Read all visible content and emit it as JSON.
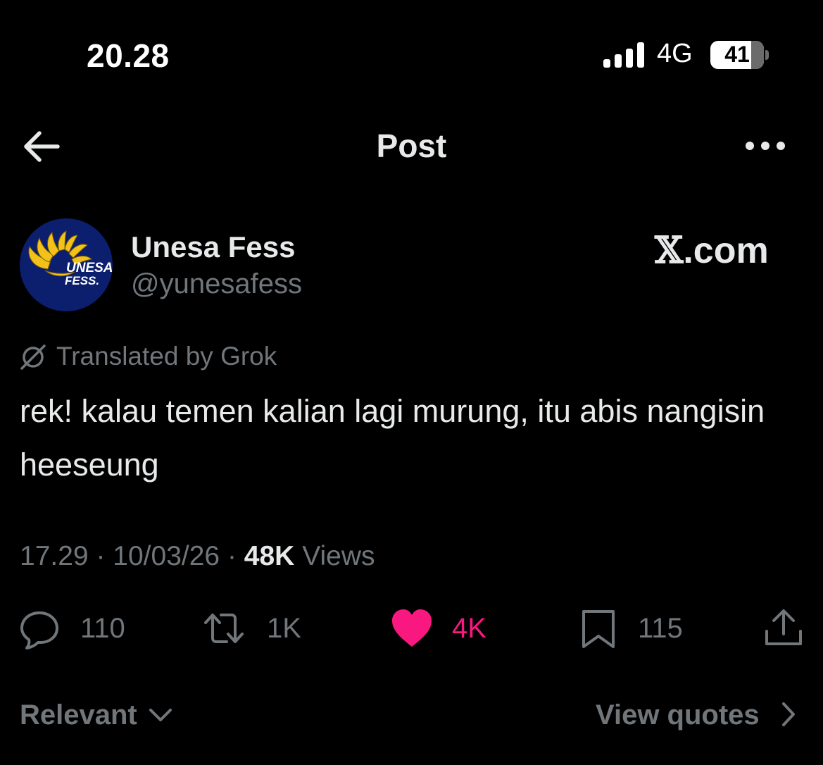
{
  "status_bar": {
    "time": "20.28",
    "network": "4G",
    "battery": "41",
    "battery_level": 0.41
  },
  "header": {
    "title": "Post",
    "back_icon": "arrow-left-icon",
    "more_icon": "more-horizontal-icon"
  },
  "author": {
    "name": "Unesa Fess",
    "handle": "@yunesafess",
    "avatar_text_1": "UNESA",
    "avatar_text_2": "FESS."
  },
  "watermark": {
    "glyph": "𝕏",
    "suffix": ".com"
  },
  "translation": {
    "label": "Translated by Grok",
    "icon": "grok-icon"
  },
  "post": {
    "text": "rek! kalau temen kalian lagi murung, itu abis nangisin heeseung",
    "time": "17.29",
    "date": "10/03/26",
    "views_count": "48K",
    "views_label": "Views",
    "separator": "·"
  },
  "actions": {
    "replies": "110",
    "reposts": "1K",
    "likes": "4K",
    "bookmarks": "115",
    "liked": true,
    "like_color": "#f91880"
  },
  "footer": {
    "sort_label": "Relevant",
    "quotes_label": "View quotes"
  }
}
